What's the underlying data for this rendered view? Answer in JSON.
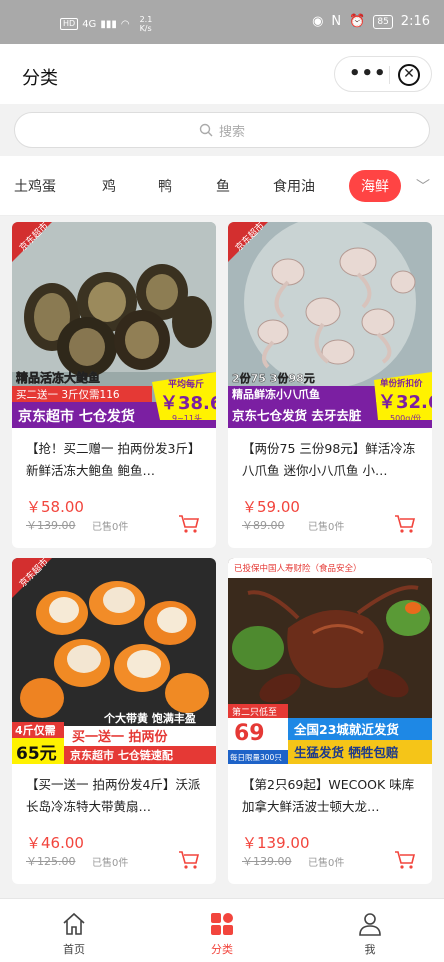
{
  "status": {
    "hd": "HD",
    "net": "4G",
    "speed_num": "2.1",
    "speed_unit": "K/s",
    "battery": "85",
    "time": "2:16"
  },
  "header": {
    "title": "分类",
    "more_icon": "more-dots-icon",
    "close_icon": "close-circle-icon"
  },
  "search": {
    "placeholder": "搜索",
    "icon": "search-icon"
  },
  "categories": {
    "items": [
      "土鸡蛋",
      "鸡",
      "鸭",
      "鱼",
      "食用油",
      "海鲜"
    ],
    "active": "海鲜",
    "accent": "#f44"
  },
  "products": [
    {
      "name": "【抢！买二赠一 拍两份发3斤】新鲜活冻大鲍鱼 鲍鱼…",
      "price": "￥58.00",
      "original": "￥139.00",
      "sold": "已售0件",
      "banner": {
        "line1": "精品活冻大鲍鱼",
        "line2": "买二送一 3斤仅需116",
        "line3": "京东超市 七仓发货",
        "price_tag": "平均每斤",
        "price": "￥38.6",
        "count": "9~11头",
        "corner": "京东超市"
      }
    },
    {
      "name": "【两份75 三份98元】鲜活冷冻八爪鱼 迷你小八爪鱼 小…",
      "price": "￥59.00",
      "original": "￥89.00",
      "sold": "已售0件",
      "banner": {
        "line1": "2份75 3份98元",
        "line2": "精品鲜冻小八爪鱼",
        "line3": "京东七仓发货 去牙去脏",
        "price_tag": "单份折扣价",
        "price": "￥32.6",
        "count": "500g/份",
        "corner": "京东超市"
      }
    },
    {
      "name": "【买一送一 拍两份发4斤】沃派 长岛冷冻特大带黄扇…",
      "price": "￥46.00",
      "original": "￥125.00",
      "sold": "已售0件",
      "banner": {
        "line1": "个大带黄 饱满丰盈",
        "line2": "买一送一 拍两份",
        "line3": "京东超市 七仓链速配",
        "price_tag": "4斤仅需",
        "price": "65元",
        "corner": "京东超市"
      }
    },
    {
      "name": "【第2只69起】WECOOK 味库加拿大鲜活波士顿大龙…",
      "price": "￥139.00",
      "original": "￥139.00",
      "sold": "已售0件",
      "banner": {
        "top": "已投保中国人寿财险（食品安全）",
        "line1": "全国23城就近发货",
        "line2": "生猛发货 牺牲包赔",
        "price_tag": "第二只低至",
        "price": "69",
        "sub": "每日限量300只"
      }
    }
  ],
  "nav": [
    {
      "label": "首页",
      "icon": "home-icon"
    },
    {
      "label": "分类",
      "icon": "category-icon"
    },
    {
      "label": "我",
      "icon": "user-icon"
    }
  ]
}
